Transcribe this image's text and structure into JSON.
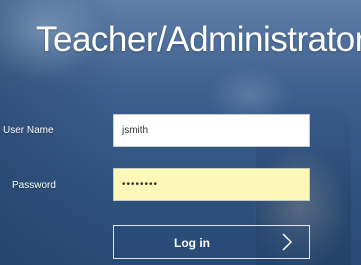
{
  "header": {
    "title": "Teacher/Administrator"
  },
  "form": {
    "username_label": "User Name",
    "username_value": "jsmith",
    "password_label": "Password",
    "password_value": "********",
    "login_label": "Log in"
  },
  "icons": {
    "login_arrow": "chevron-right-icon"
  },
  "colors": {
    "password_bg": "#fdf8b8",
    "input_bg": "#ffffff",
    "text": "#ffffff"
  }
}
